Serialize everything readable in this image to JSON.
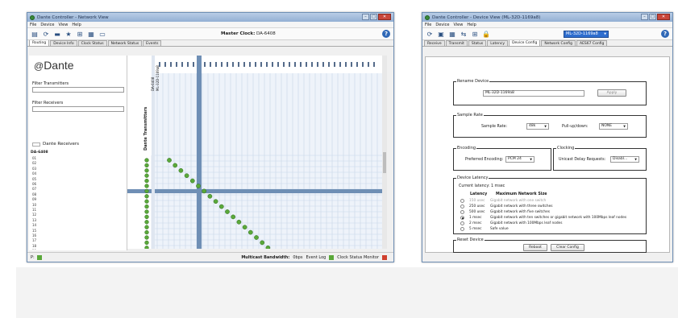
{
  "network_view": {
    "title": "Dante Controller - Network View",
    "menu": [
      "File",
      "Device",
      "View",
      "Help"
    ],
    "master_clock_label": "Master Clock:",
    "master_clock_value": "DA-6408",
    "help": "?",
    "tabs": [
      "Routing",
      "Device Info",
      "Clock Status",
      "Network Status",
      "Events"
    ],
    "active_tab": 0,
    "logo": "Dante",
    "filter_transmitters": "Filter Transmitters",
    "filter_receivers": "Filter Receivers",
    "dante_transmitters": "Dante Transmitters",
    "dante_receivers": "Dante Receivers",
    "transmitter_devices": [
      "DA-6408",
      "ML-32D-1169a8"
    ],
    "receiver_device": "DA-6408",
    "receiver_channels": [
      "01",
      "02",
      "03",
      "04",
      "05",
      "06",
      "07",
      "08",
      "09",
      "10",
      "11",
      "12",
      "13",
      "14",
      "15",
      "16",
      "17",
      "18",
      "19"
    ],
    "status_prefix": "P:",
    "multicast_label": "Multicast Bandwidth:",
    "multicast_value": "0bps",
    "event_log": "Event Log",
    "clock_status_monitor": "Clock Status Monitor"
  },
  "device_view": {
    "title": "Dante Controller - Device View (ML-32D-1169a8)",
    "menu": [
      "File",
      "Device",
      "View",
      "Help"
    ],
    "device_selected": "ML-32D-1169a8",
    "help": "?",
    "tabs": [
      "Receive",
      "Transmit",
      "Status",
      "Latency",
      "Device Config",
      "Network Config",
      "AES67 Config"
    ],
    "active_tab": 4,
    "rename": {
      "legend": "Rename Device",
      "value": "ML-32D-1169a8",
      "apply": "Apply"
    },
    "sample_rate": {
      "legend": "Sample Rate",
      "label": "Sample Rate:",
      "value": "48k",
      "pull_label": "Pull-up/down:",
      "pull_value": "NONE"
    },
    "encoding": {
      "legend": "Encoding",
      "label": "Preferred Encoding:",
      "value": "PCM 24"
    },
    "clocking": {
      "legend": "Clocking",
      "label": "Unicast Delay Requests:",
      "value": "Disabl..."
    },
    "latency": {
      "legend": "Device Latency",
      "current": "Current latency: 1 msec",
      "col_latency": "Latency",
      "col_size": "Maximum Network Size",
      "rows": [
        {
          "latency": "150 usec",
          "size": "Gigabit network with one switch",
          "selected": false,
          "muted": true
        },
        {
          "latency": "250 usec",
          "size": "Gigabit network with three switches",
          "selected": false,
          "muted": false
        },
        {
          "latency": "500 usec",
          "size": "Gigabit network with five switches",
          "selected": false,
          "muted": false
        },
        {
          "latency": "1 msec",
          "size": "Gigabit network with ten switches or gigabit network with 100Mbps leaf nodes",
          "selected": true,
          "muted": false
        },
        {
          "latency": "2 msec",
          "size": "Gigabit network with 100Mbps leaf nodes",
          "selected": false,
          "muted": false
        },
        {
          "latency": "5 msec",
          "size": "Safe value",
          "selected": false,
          "muted": false
        }
      ]
    },
    "reset": {
      "legend": "Reset Device",
      "reboot": "Reboot",
      "clear": "Clear Config"
    }
  },
  "colors": {
    "accent_blue": "#2f6ecf",
    "grid_line": "#6f8fb5",
    "check_green": "#5aa83a",
    "error_red": "#d0402e"
  }
}
